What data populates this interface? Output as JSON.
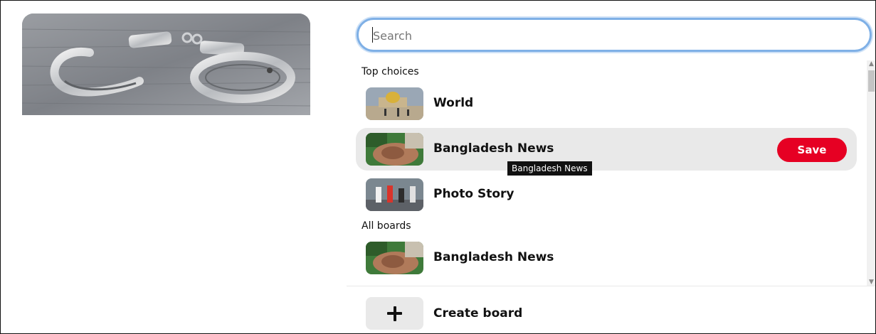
{
  "search": {
    "placeholder": "Search",
    "value": ""
  },
  "sections": {
    "top_choices": "Top choices",
    "all_boards": "All boards"
  },
  "top_choices": [
    {
      "name": "World",
      "thumb": "world-thumbnail"
    },
    {
      "name": "Bangladesh News",
      "thumb": "bangladesh-news-thumbnail",
      "hovered": true
    },
    {
      "name": "Photo Story",
      "thumb": "photo-story-thumbnail"
    }
  ],
  "all_boards": [
    {
      "name": "Bangladesh News",
      "thumb": "bangladesh-news-thumbnail"
    }
  ],
  "save_label": "Save",
  "tooltip": "Bangladesh News",
  "create_board": {
    "label": "Create board",
    "icon": "plus-icon"
  },
  "pin_image": {
    "subject": "handcuffs-image"
  },
  "colors": {
    "save": "#e60023",
    "focus_ring": "#7fb0e6",
    "hover_row": "#e9e9e9"
  }
}
